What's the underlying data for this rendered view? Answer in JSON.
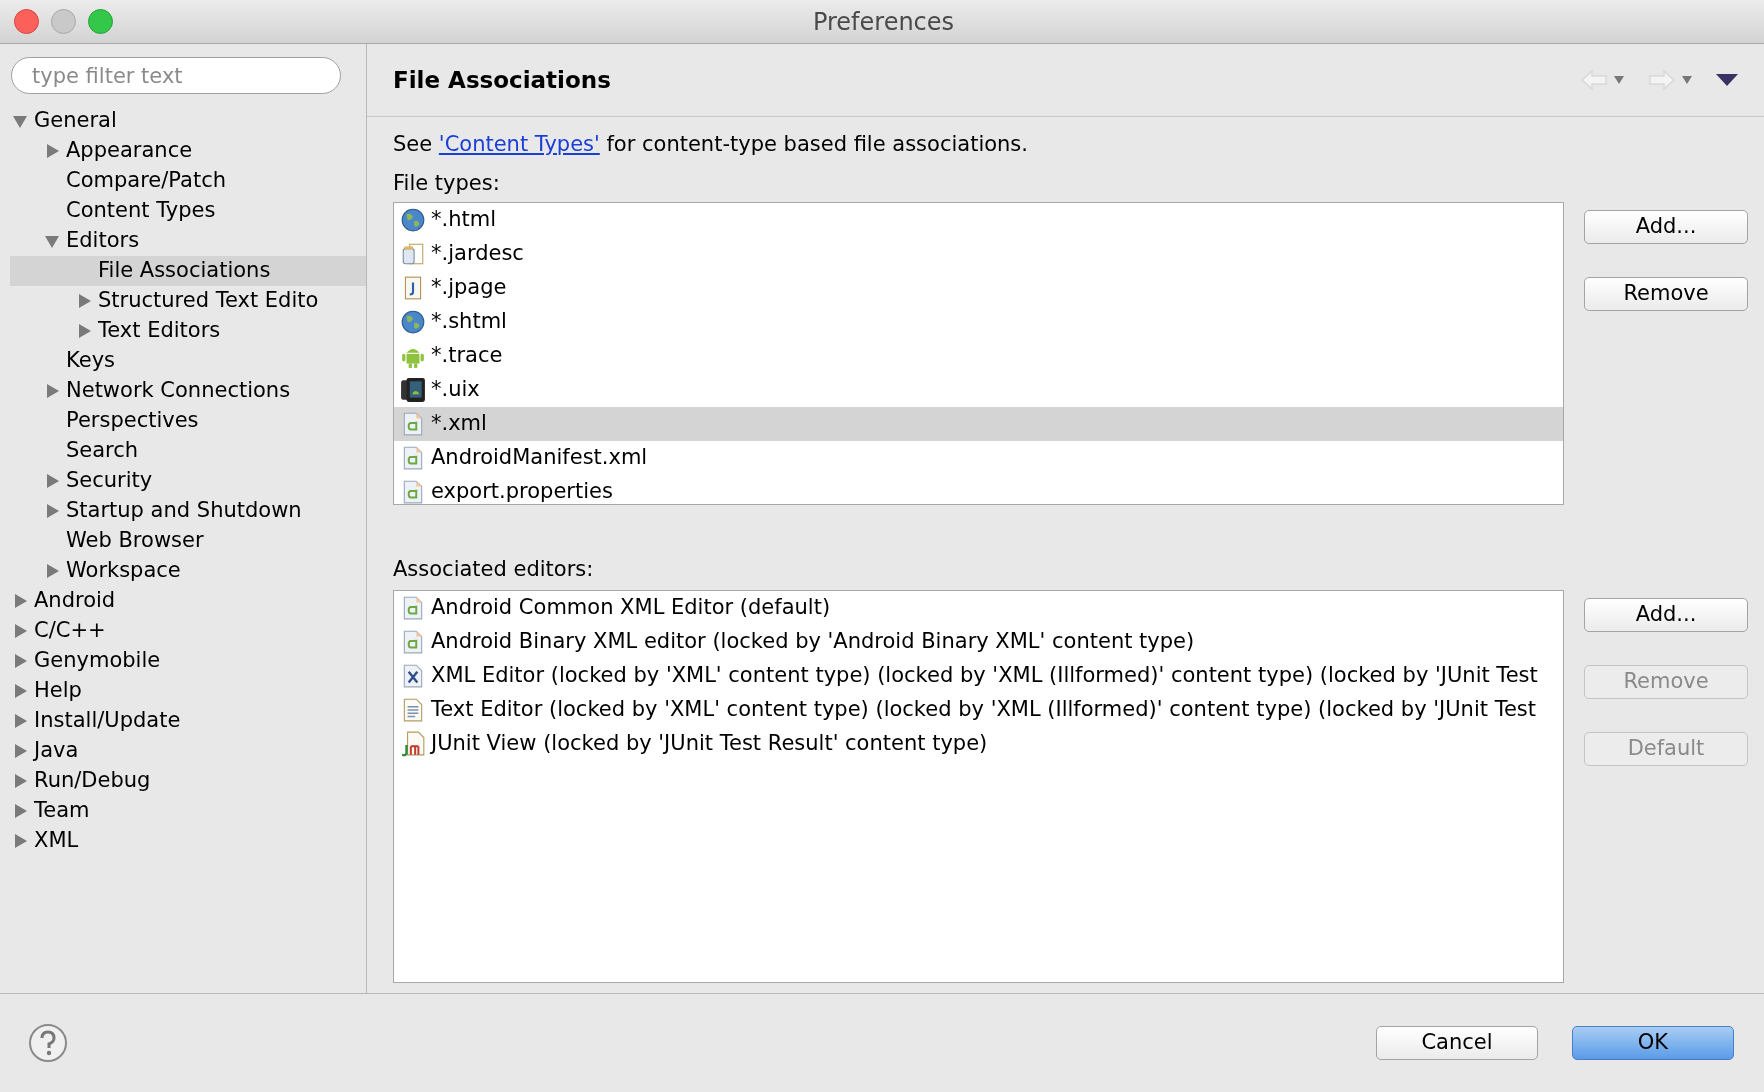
{
  "window": {
    "title": "Preferences"
  },
  "sidebar": {
    "filter": {
      "placeholder": "type filter text"
    },
    "tree": [
      {
        "label": "General",
        "kind": "branch",
        "expanded": true,
        "selected": false,
        "children": [
          {
            "label": "Appearance",
            "kind": "branch",
            "expanded": false,
            "selected": false
          },
          {
            "label": "Compare/Patch",
            "kind": "leaf",
            "selected": false
          },
          {
            "label": "Content Types",
            "kind": "leaf",
            "selected": false
          },
          {
            "label": "Editors",
            "kind": "branch",
            "expanded": true,
            "selected": false,
            "children": [
              {
                "label": "File Associations",
                "kind": "leaf",
                "selected": true
              },
              {
                "label": "Structured Text Edito",
                "kind": "branch",
                "expanded": false,
                "selected": false
              },
              {
                "label": "Text Editors",
                "kind": "branch",
                "expanded": false,
                "selected": false
              }
            ]
          },
          {
            "label": "Keys",
            "kind": "leaf",
            "selected": false
          },
          {
            "label": "Network Connections",
            "kind": "branch",
            "expanded": false,
            "selected": false
          },
          {
            "label": "Perspectives",
            "kind": "leaf",
            "selected": false
          },
          {
            "label": "Search",
            "kind": "leaf",
            "selected": false
          },
          {
            "label": "Security",
            "kind": "branch",
            "expanded": false,
            "selected": false
          },
          {
            "label": "Startup and Shutdown",
            "kind": "branch",
            "expanded": false,
            "selected": false
          },
          {
            "label": "Web Browser",
            "kind": "leaf",
            "selected": false
          },
          {
            "label": "Workspace",
            "kind": "branch",
            "expanded": false,
            "selected": false
          }
        ]
      },
      {
        "label": "Android",
        "kind": "branch",
        "expanded": false,
        "selected": false
      },
      {
        "label": "C/C++",
        "kind": "branch",
        "expanded": false,
        "selected": false
      },
      {
        "label": "Genymobile",
        "kind": "branch",
        "expanded": false,
        "selected": false
      },
      {
        "label": "Help",
        "kind": "branch",
        "expanded": false,
        "selected": false
      },
      {
        "label": "Install/Update",
        "kind": "branch",
        "expanded": false,
        "selected": false
      },
      {
        "label": "Java",
        "kind": "branch",
        "expanded": false,
        "selected": false
      },
      {
        "label": "Run/Debug",
        "kind": "branch",
        "expanded": false,
        "selected": false
      },
      {
        "label": "Team",
        "kind": "branch",
        "expanded": false,
        "selected": false
      },
      {
        "label": "XML",
        "kind": "branch",
        "expanded": false,
        "selected": false
      }
    ]
  },
  "page": {
    "title": "File Associations",
    "intro": {
      "before": "See ",
      "link": "'Content Types'",
      "after": " for content-type based file associations."
    },
    "file_types": {
      "label": "File types:",
      "items": [
        {
          "name": "*.html",
          "kind": "web",
          "selected": false
        },
        {
          "name": "*.jardesc",
          "kind": "jar",
          "selected": false
        },
        {
          "name": "*.jpage",
          "kind": "java-page",
          "selected": false
        },
        {
          "name": "*.shtml",
          "kind": "web",
          "selected": false
        },
        {
          "name": "*.trace",
          "kind": "android",
          "selected": false
        },
        {
          "name": "*.uix",
          "kind": "device",
          "selected": false
        },
        {
          "name": "*.xml",
          "kind": "android-xml",
          "selected": true
        },
        {
          "name": "AndroidManifest.xml",
          "kind": "android-xml",
          "selected": false
        },
        {
          "name": "export.properties",
          "kind": "android-xml",
          "selected": false
        }
      ],
      "buttons": [
        {
          "label": "Add...",
          "disabled": false
        },
        {
          "label": "Remove",
          "disabled": false
        }
      ]
    },
    "editors": {
      "label": "Associated editors:",
      "items": [
        {
          "name": "Android Common XML Editor (default)",
          "kind": "android-xml"
        },
        {
          "name": "Android Binary XML editor (locked by 'Android Binary XML' content type)",
          "kind": "android-xml"
        },
        {
          "name": "XML Editor (locked by 'XML' content type) (locked by 'XML (Illformed)' content type) (locked by 'JUnit Test",
          "kind": "xml"
        },
        {
          "name": "Text Editor (locked by 'XML' content type) (locked by 'XML (Illformed)' content type) (locked by 'JUnit Test",
          "kind": "text"
        },
        {
          "name": "JUnit View (locked by 'JUnit Test Result' content type)",
          "kind": "junit"
        }
      ],
      "buttons": [
        {
          "label": "Add...",
          "disabled": false
        },
        {
          "label": "Remove",
          "disabled": true
        },
        {
          "label": "Default",
          "disabled": true
        }
      ]
    }
  },
  "footer": {
    "buttons": [
      {
        "label": "Cancel",
        "kind": "normal"
      },
      {
        "label": "OK",
        "kind": "default"
      }
    ]
  }
}
